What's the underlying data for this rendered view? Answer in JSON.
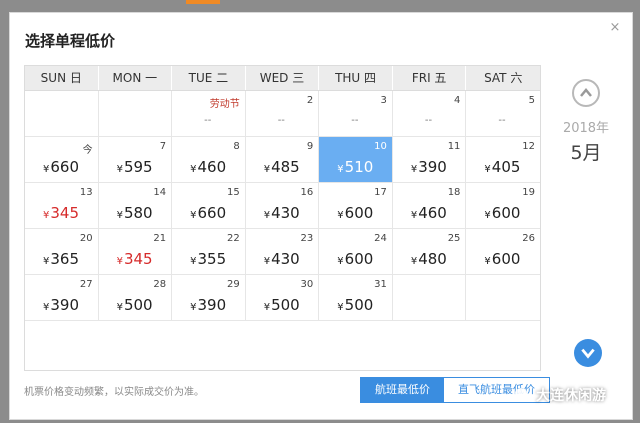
{
  "dialog": {
    "title": "选择单程低价",
    "close_glyph": "×",
    "weekdays": [
      "SUN 日",
      "MON 一",
      "TUE 二",
      "WED 三",
      "THU 四",
      "FRI 五",
      "SAT 六"
    ],
    "year_label": "2018年",
    "month_label": "5月",
    "currency": "¥",
    "cells": [
      {
        "day": "",
        "price": ""
      },
      {
        "day": "",
        "price": ""
      },
      {
        "day": "劳动节",
        "price": "--",
        "holiday": true
      },
      {
        "day": "2",
        "price": "--"
      },
      {
        "day": "3",
        "price": "--"
      },
      {
        "day": "4",
        "price": "--"
      },
      {
        "day": "5",
        "price": "--"
      },
      {
        "day": "今",
        "price": "660"
      },
      {
        "day": "7",
        "price": "595"
      },
      {
        "day": "8",
        "price": "460"
      },
      {
        "day": "9",
        "price": "485"
      },
      {
        "day": "10",
        "price": "510",
        "selected": true
      },
      {
        "day": "11",
        "price": "390"
      },
      {
        "day": "12",
        "price": "405"
      },
      {
        "day": "13",
        "price": "345",
        "low": true
      },
      {
        "day": "14",
        "price": "580"
      },
      {
        "day": "15",
        "price": "660"
      },
      {
        "day": "16",
        "price": "430"
      },
      {
        "day": "17",
        "price": "600"
      },
      {
        "day": "18",
        "price": "460"
      },
      {
        "day": "19",
        "price": "600"
      },
      {
        "day": "20",
        "price": "365"
      },
      {
        "day": "21",
        "price": "345",
        "low": true
      },
      {
        "day": "22",
        "price": "355"
      },
      {
        "day": "23",
        "price": "430"
      },
      {
        "day": "24",
        "price": "600"
      },
      {
        "day": "25",
        "price": "480"
      },
      {
        "day": "26",
        "price": "600"
      },
      {
        "day": "27",
        "price": "390"
      },
      {
        "day": "28",
        "price": "500"
      },
      {
        "day": "29",
        "price": "390"
      },
      {
        "day": "30",
        "price": "500"
      },
      {
        "day": "31",
        "price": "500"
      },
      {
        "day": "",
        "price": ""
      },
      {
        "day": "",
        "price": ""
      }
    ],
    "note": "机票价格变动频繁，以实际成交价为准。",
    "toggle": {
      "active_label": "航班最低价",
      "inactive_label": "直飞航班最低价"
    }
  },
  "watermark": {
    "text": "大连休闲游"
  },
  "colors": {
    "accent": "#3a8de0",
    "selected": "#6aaef2",
    "low_price": "#d62b2b",
    "holiday": "#c0392b",
    "orange_tab": "#f08a24"
  },
  "icons": {
    "up": "chevron-up-circle-icon",
    "down": "chevron-down-circle-icon",
    "close": "close-icon",
    "watermark": "wechat-icon"
  }
}
